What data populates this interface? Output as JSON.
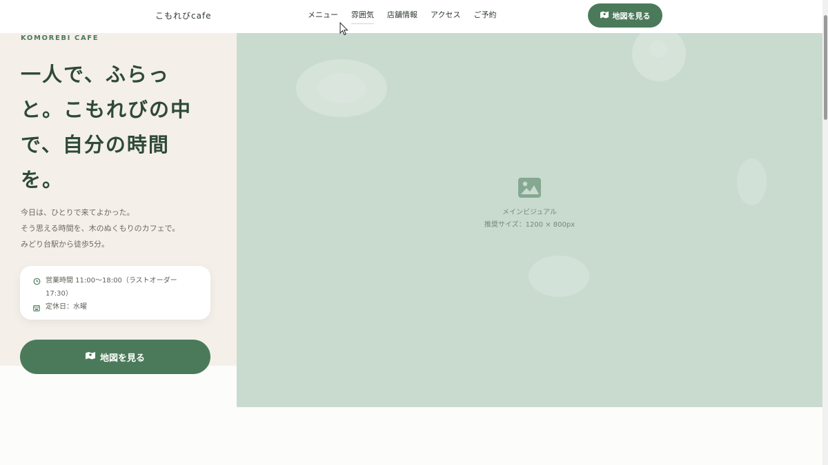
{
  "header": {
    "logo": "こもれびcafe",
    "nav": [
      "メニュー",
      "雰囲気",
      "店舗情報",
      "アクセス",
      "ご予約"
    ],
    "active_nav": "雰囲気",
    "cta_label": "地図を見る"
  },
  "hero": {
    "eyebrow": "KOMOREBI CAFE",
    "headline": "一人で、ふらっと。こもれびの中で、自分の時間を。",
    "lead": [
      "今日は、ひとりで来てよかった。",
      "そう思える時間を、木のぬくもりのカフェで。",
      "みどり台駅から徒歩5分。"
    ],
    "hours": "営業時間 11:00〜18:00（ラストオーダー 17:30）",
    "closed": "定休日：水曜",
    "cta_label": "地図を見る"
  },
  "visual": {
    "title": "メインビジュアル",
    "recommended_size": "推奨サイズ：1200 × 800px",
    "icon": "image-icon"
  },
  "colors": {
    "accent": "#4b7a5a",
    "headline": "#2e4a36",
    "panel_bg": "#f4efe9",
    "visual_bg": "#c9dbcf"
  }
}
